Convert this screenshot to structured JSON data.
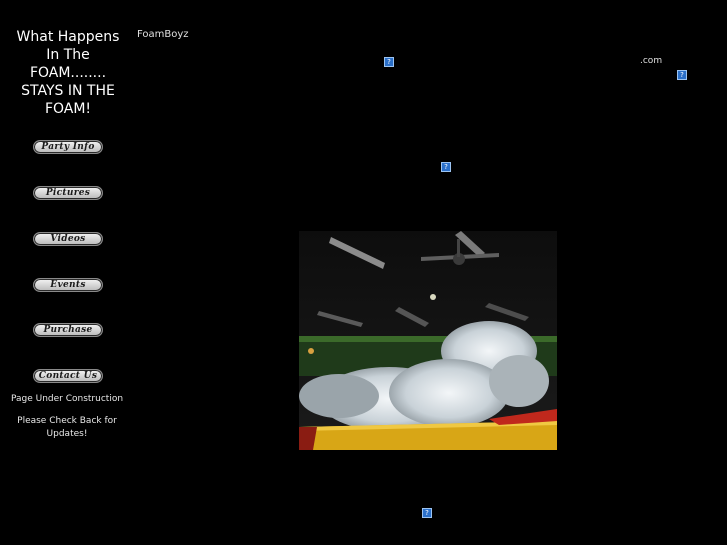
{
  "sidebar": {
    "tagline": "What Happens\nIn The\nFOAM........\nSTAYS IN THE\nFOAM!",
    "nav": [
      {
        "label": "Party Info"
      },
      {
        "label": "Pictures"
      },
      {
        "label": "Videos"
      },
      {
        "label": "Events"
      },
      {
        "label": "Purchase"
      },
      {
        "label": "Contact Us"
      }
    ],
    "notice_1": "Page Under Construction",
    "notice_2": "Please Check Back for Updates!"
  },
  "header": {
    "brand": "FoamBoyz",
    "domain_suffix": ".com"
  },
  "broken_image_glyph": "?",
  "colors": {
    "background": "#000000",
    "text": "#ffffff",
    "broken_icon": "#2a6fc9",
    "foam": "#e8eef3",
    "inflatable": "#e2b21a"
  }
}
